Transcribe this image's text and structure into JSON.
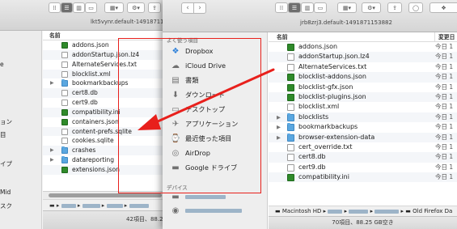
{
  "back_window": {
    "title": "lkt5vynr.default-1491871153882",
    "column_header": "名前",
    "sidebar_partial": [
      "e",
      "ョン",
      "目",
      "イプ",
      "Mid",
      "スク"
    ],
    "rows": [
      {
        "name": "addons.json",
        "kind": "green",
        "expander": ""
      },
      {
        "name": "addonStartup.json.lz4",
        "kind": "doc",
        "expander": ""
      },
      {
        "name": "AlternateServices.txt",
        "kind": "doc",
        "expander": ""
      },
      {
        "name": "blocklist.xml",
        "kind": "doc",
        "expander": ""
      },
      {
        "name": "bookmarkbackups",
        "kind": "folder",
        "expander": "▶"
      },
      {
        "name": "cert8.db",
        "kind": "doc",
        "expander": ""
      },
      {
        "name": "cert9.db",
        "kind": "doc",
        "expander": ""
      },
      {
        "name": "compatibility.ini",
        "kind": "green",
        "expander": ""
      },
      {
        "name": "containers.json",
        "kind": "green",
        "expander": ""
      },
      {
        "name": "content-prefs.sqlite",
        "kind": "doc",
        "expander": ""
      },
      {
        "name": "cookies.sqlite",
        "kind": "doc",
        "expander": ""
      },
      {
        "name": "crashes",
        "kind": "folder",
        "expander": "▶"
      },
      {
        "name": "datareporting",
        "kind": "folder",
        "expander": "▶"
      },
      {
        "name": "extensions.json",
        "kind": "green",
        "expander": ""
      }
    ],
    "status": "42項目、88.25"
  },
  "front_window": {
    "title": "jrb8zrj3.default-1491871153882",
    "column_name": "名前",
    "column_date": "変更日",
    "sidebar": {
      "favorites_header": "よく使う項目",
      "items": [
        {
          "label": "Dropbox",
          "icon": "dropbox-icon",
          "glyph": "❖"
        },
        {
          "label": "iCloud Drive",
          "icon": "cloud-icon",
          "glyph": "☁"
        },
        {
          "label": "書類",
          "icon": "documents-icon",
          "glyph": "▤"
        },
        {
          "label": "ダウンロード",
          "icon": "download-icon",
          "glyph": "⬇"
        },
        {
          "label": "デスクトップ",
          "icon": "desktop-icon",
          "glyph": "▭"
        },
        {
          "label": "アプリケーション",
          "icon": "applications-icon",
          "glyph": "✈"
        },
        {
          "label": "最近使った項目",
          "icon": "recents-icon",
          "glyph": "⌚"
        },
        {
          "label": "AirDrop",
          "icon": "airdrop-icon",
          "glyph": "◎"
        },
        {
          "label": "Google ドライブ",
          "icon": "folder-icon",
          "glyph": "▬"
        }
      ],
      "devices_header": "デバイス"
    },
    "rows": [
      {
        "name": "addons.json",
        "kind": "green",
        "expander": "",
        "date": "今日 1"
      },
      {
        "name": "addonStartup.json.lz4",
        "kind": "doc",
        "expander": "",
        "date": "今日 1"
      },
      {
        "name": "AlternateServices.txt",
        "kind": "doc",
        "expander": "",
        "date": "今日 1"
      },
      {
        "name": "blocklist-addons.json",
        "kind": "green",
        "expander": "",
        "date": "今日 1"
      },
      {
        "name": "blocklist-gfx.json",
        "kind": "green",
        "expander": "",
        "date": "今日 1"
      },
      {
        "name": "blocklist-plugins.json",
        "kind": "green",
        "expander": "",
        "date": "今日 1"
      },
      {
        "name": "blocklist.xml",
        "kind": "doc",
        "expander": "",
        "date": "今日 1"
      },
      {
        "name": "blocklists",
        "kind": "folder",
        "expander": "▶",
        "date": "今日 1"
      },
      {
        "name": "bookmarkbackups",
        "kind": "folder",
        "expander": "▶",
        "date": "今日 1"
      },
      {
        "name": "browser-extension-data",
        "kind": "folder",
        "expander": "▶",
        "date": "今日 1"
      },
      {
        "name": "cert_override.txt",
        "kind": "doc",
        "expander": "",
        "date": "今日 1"
      },
      {
        "name": "cert8.db",
        "kind": "doc",
        "expander": "",
        "date": "今日 1"
      },
      {
        "name": "cert9.db",
        "kind": "doc",
        "expander": "",
        "date": "今日 1"
      },
      {
        "name": "compatibility.ini",
        "kind": "green",
        "expander": "",
        "date": "今日 1"
      }
    ],
    "path_start": "Macintosh HD",
    "path_end": "Old Firefox Da",
    "status": "70項目、88.25 GB空き"
  },
  "colors": {
    "highlight": "#e8201c",
    "folder": "#5aa7e0",
    "json_green": "#2f8a2a"
  }
}
